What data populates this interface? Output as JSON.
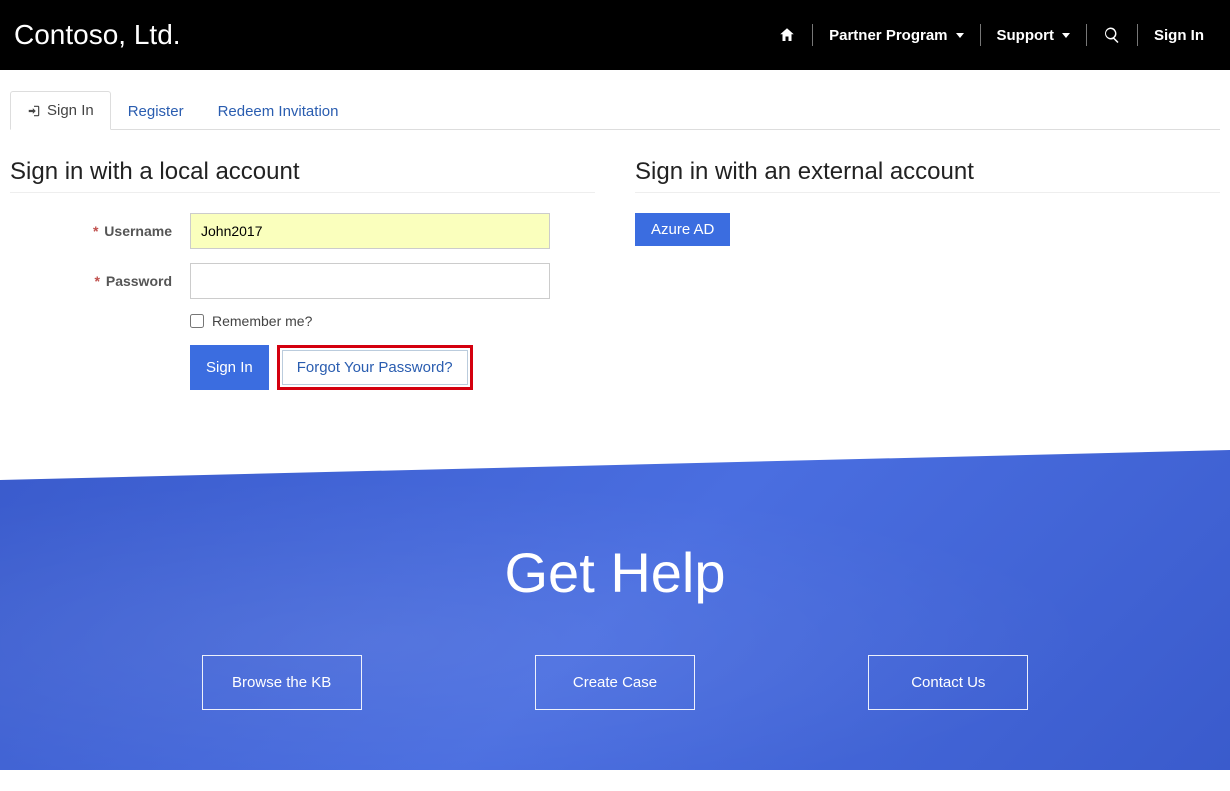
{
  "brand": "Contoso, Ltd.",
  "nav": {
    "partner_program": "Partner Program",
    "support": "Support",
    "sign_in": "Sign In"
  },
  "tabs": {
    "sign_in": "Sign In",
    "register": "Register",
    "redeem": "Redeem Invitation"
  },
  "local": {
    "heading": "Sign in with a local account",
    "username_label": "Username",
    "username_value": "John2017",
    "password_label": "Password",
    "password_value": "",
    "remember_label": "Remember me?",
    "sign_in_button": "Sign In",
    "forgot_button": "Forgot Your Password?"
  },
  "external": {
    "heading": "Sign in with an external account",
    "azure_button": "Azure AD"
  },
  "hero": {
    "title": "Get Help",
    "browse_kb": "Browse the KB",
    "create_case": "Create Case",
    "contact_us": "Contact Us"
  }
}
